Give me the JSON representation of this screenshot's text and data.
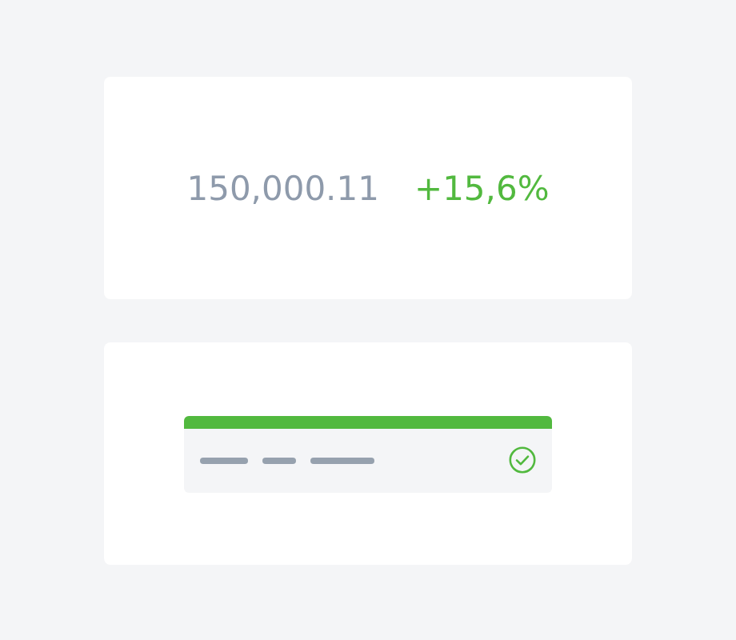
{
  "stat": {
    "value": "150,000.11",
    "change": "+15,6%",
    "positive": true
  },
  "status_panel": {
    "success": true
  }
}
